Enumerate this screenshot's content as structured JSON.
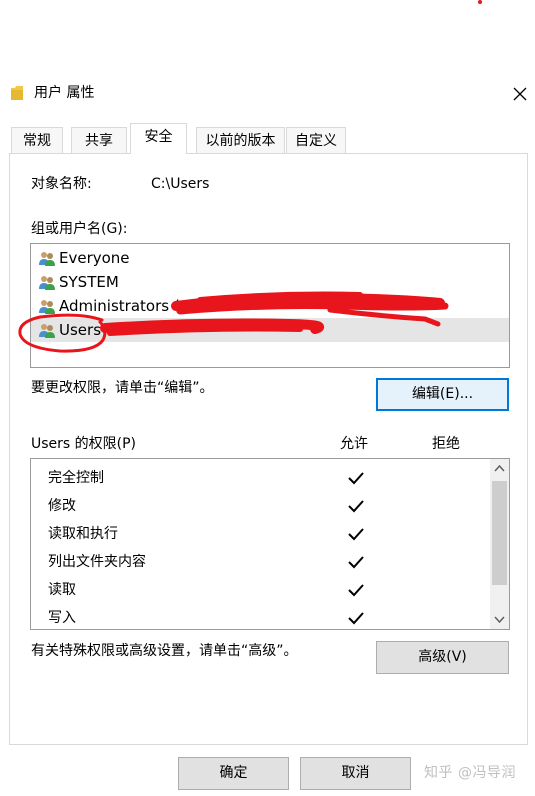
{
  "window": {
    "title": "用户 属性",
    "icon": "folder-icon",
    "close_icon": "close-icon"
  },
  "tabs": [
    {
      "label": "常规",
      "active": false
    },
    {
      "label": "共享",
      "active": false
    },
    {
      "label": "安全",
      "active": true
    },
    {
      "label": "以前的版本",
      "active": false
    },
    {
      "label": "自定义",
      "active": false
    }
  ],
  "security": {
    "object_name_label": "对象名称:",
    "object_name_value": "C:\\Users",
    "groups_label": "组或用户名(G):",
    "groups": [
      {
        "name": "Everyone",
        "icon": "users-group-icon",
        "selected": false
      },
      {
        "name": "SYSTEM",
        "icon": "users-group-icon",
        "selected": false
      },
      {
        "name": "Administrators (",
        "icon": "users-group-icon",
        "selected": false
      },
      {
        "name": "Users",
        "icon": "users-group-icon",
        "selected": true
      }
    ],
    "change_hint": "要更改权限，请单击“编辑”。",
    "edit_button": "编辑(E)...",
    "permissions_label": "Users 的权限(P)",
    "allow_header": "允许",
    "deny_header": "拒绝",
    "permissions": [
      {
        "name": "完全控制",
        "allow": true,
        "deny": false
      },
      {
        "name": "修改",
        "allow": true,
        "deny": false
      },
      {
        "name": "读取和执行",
        "allow": true,
        "deny": false
      },
      {
        "name": "列出文件夹内容",
        "allow": true,
        "deny": false
      },
      {
        "name": "读取",
        "allow": true,
        "deny": false
      },
      {
        "name": "写入",
        "allow": true,
        "deny": false
      }
    ],
    "advanced_hint": "有关特殊权限或高级设置，请单击“高级”。",
    "advanced_button": "高级(V)"
  },
  "footer": {
    "ok_button": "确定",
    "cancel_button": "取消"
  },
  "watermark": "知乎 @冯导润",
  "colors": {
    "scribble": "#e8161c",
    "focus_border": "#0078d7",
    "selected_row": "#e5e5e5",
    "folder": "#f0c94a"
  }
}
